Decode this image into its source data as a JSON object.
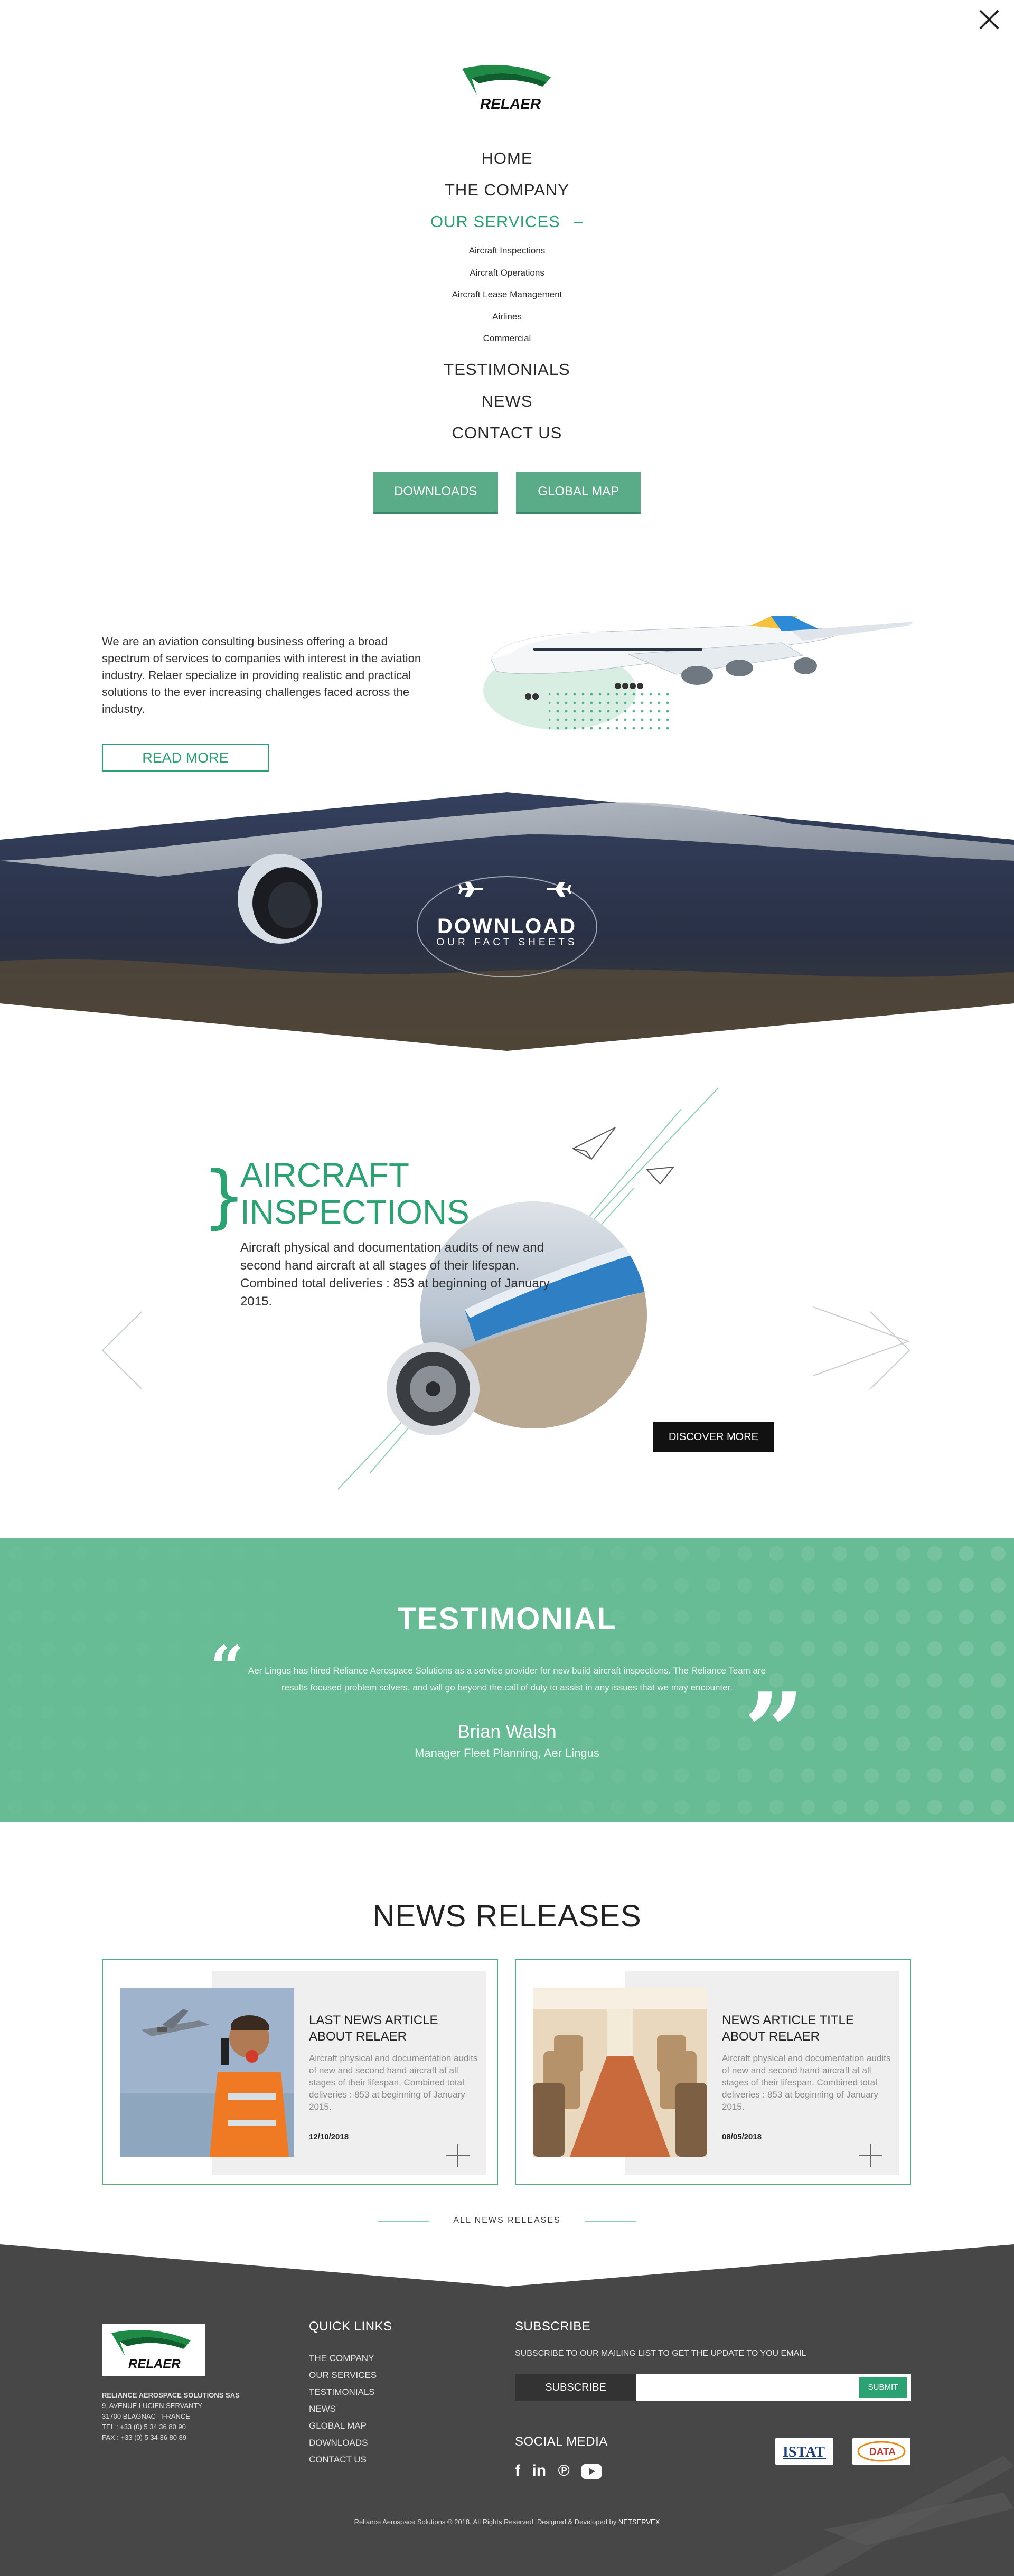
{
  "menu": {
    "logo_text": "RELAER",
    "items": [
      {
        "label": "HOME"
      },
      {
        "label": "THE COMPANY"
      },
      {
        "label": "OUR SERVICES",
        "active": true
      },
      {
        "label": "TESTIMONIALS"
      },
      {
        "label": "NEWS"
      },
      {
        "label": "CONTACT US"
      }
    ],
    "service_dash": "–",
    "services": [
      "Aircraft Inspections",
      "Aircraft Operations",
      "Aircraft Lease Management",
      "Airlines",
      "Commercial"
    ],
    "buttons": [
      "DOWNLOADS",
      "GLOBAL MAP"
    ]
  },
  "about": {
    "text": "We are an aviation consulting business offering a broad spectrum of services to companies with interest in the aviation industry. Relaer specialize in providing realistic and practical solutions to the ever increasing challenges faced across the industry.",
    "button": "READ MORE"
  },
  "banner": {
    "title": "DOWNLOAD",
    "subtitle": "OUR FACT SHEETS"
  },
  "service_slide": {
    "brace": "}",
    "title_line1": "AIRCRAFT",
    "title_line2": "INSPECTIONS",
    "description": "Aircraft physical and documentation audits of new and second hand aircraft at all stages of their lifespan. Combined total deliveries : 853 at beginning of January 2015.",
    "button": "DISCOVER MORE"
  },
  "testimonial": {
    "title": "TESTIMONIAL",
    "quote": "Aer Lingus has hired Reliance Aerospace Solutions as a service provider for new build aircraft inspections. The Reliance Team are results focused problem solvers, and will go beyond the call of duty to assist in any issues that we may encounter.",
    "name": "Brian Walsh",
    "role": "Manager Fleet Planning, Aer Lingus",
    "open_quote": "“",
    "close_quote": "”"
  },
  "news": {
    "title": "NEWS RELEASES",
    "cards": [
      {
        "headline": "LAST NEWS ARTICLE ABOUT RELAER",
        "body": "Aircraft physical and documentation audits of new and second hand aircraft at all stages of their lifespan. Combined total deliveries : 853 at beginning of January 2015.",
        "date": "12/10/2018"
      },
      {
        "headline": "NEWS ARTICLE TITLE ABOUT RELAER",
        "body": "Aircraft physical and documentation audits of new and second hand aircraft at all stages of their lifespan. Combined total deliveries : 853 at beginning of January 2015.",
        "date": "08/05/2018"
      }
    ],
    "all_link": "ALL NEWS RELEASES"
  },
  "footer": {
    "company": "RELIANCE AEROSPACE SOLUTIONS SAS",
    "address1": "9, AVENUE LUCIEN SERVANTY",
    "address2": "31700 BLAGNAC - FRANCE",
    "tel": "TEL : +33 (0) 5 34 36 80 90",
    "fax": "FAX : +33 (0) 5 34 36 80 89",
    "quick_links_title": "QUICK LINKS",
    "quick_links": [
      "THE COMPANY",
      "OUR SERVICES",
      "TESTIMONIALS",
      "NEWS",
      "GLOBAL MAP",
      "DOWNLOADS",
      "CONTACT US"
    ],
    "subscribe_title": "SUBSCRIBE",
    "subscribe_text": "SUBSCRIBE TO OUR MAILING LIST TO GET THE UPDATE TO YOU EMAIL",
    "subscribe_label": "SUBSCRIBE",
    "email_value": "",
    "submit": "SUBMIT",
    "social_title": "SOCIAL MEDIA",
    "social_icons": [
      "facebook-icon",
      "linkedin-icon",
      "pinterest-icon",
      "youtube-icon"
    ],
    "partner1": "ISTAT",
    "partner2": "DATA",
    "copyright_prefix": "Reliance Aerospace Solutions © 2018. All Rights Reserved. Designed & Developed by ",
    "copyright_link": "NETSERVEX"
  },
  "colors": {
    "brand_green": "#2aa272",
    "button_green": "#5aac89",
    "testimonial_bg": "#67bc95",
    "footer_bg": "#474747",
    "banner_dark": "#26314a"
  }
}
